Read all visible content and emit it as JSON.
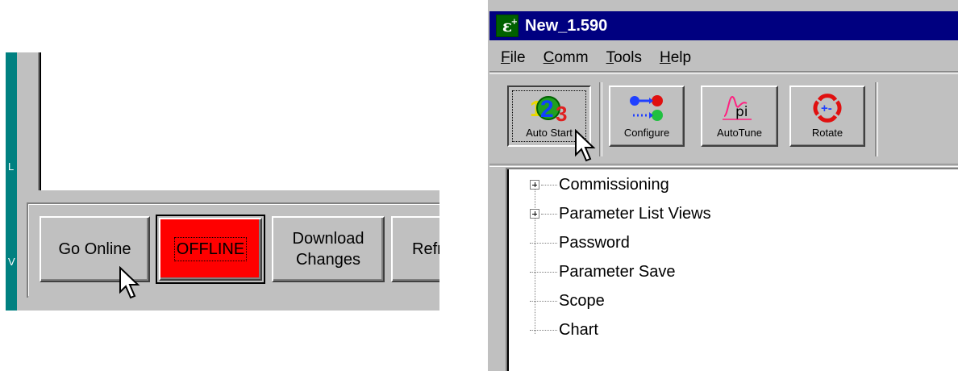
{
  "left_panel": {
    "edge_letters": [
      "L",
      "V"
    ],
    "buttons": {
      "go_online": "Go Online",
      "offline": "OFFLINE",
      "download_changes": "Download\nChanges",
      "refresh_partial": "Refr"
    },
    "colors": {
      "offline_bg": "#ff0000",
      "teal_strip": "#008080"
    }
  },
  "window": {
    "title": "New_1.590",
    "app_icon": "epsilon-icon",
    "menu": [
      {
        "label": "File",
        "underline": "F"
      },
      {
        "label": "Comm",
        "underline": "C"
      },
      {
        "label": "Tools",
        "underline": "T"
      },
      {
        "label": "Help",
        "underline": "H"
      }
    ],
    "toolbar": [
      {
        "label": "Auto Start",
        "icon": "auto-start-123-icon",
        "pressed": true
      },
      {
        "label": "Configure",
        "icon": "configure-icon"
      },
      {
        "label": "AutoTune",
        "icon": "autotune-pi-icon"
      },
      {
        "label": "Rotate",
        "icon": "rotate-icon"
      }
    ],
    "tree": [
      {
        "label": "Commissioning",
        "expandable": true
      },
      {
        "label": "Parameter List Views",
        "expandable": true
      },
      {
        "label": "Password",
        "expandable": false
      },
      {
        "label": "Parameter Save",
        "expandable": false
      },
      {
        "label": "Scope",
        "expandable": false
      },
      {
        "label": "Chart",
        "expandable": false
      }
    ],
    "colors": {
      "titlebar": "#000080",
      "face": "#c0c0c0"
    }
  }
}
